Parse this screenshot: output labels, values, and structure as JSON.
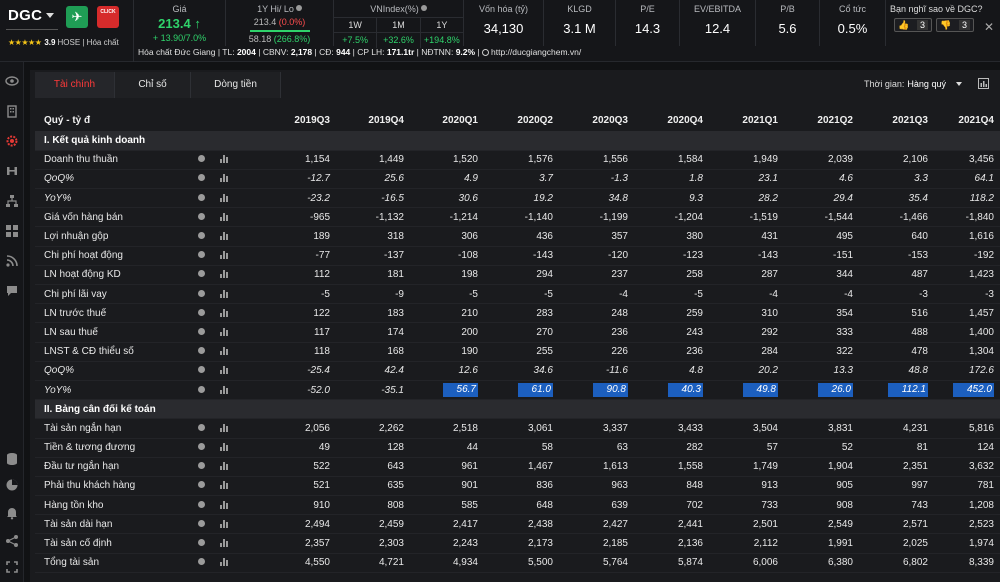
{
  "header": {
    "ticker": "DGC",
    "badge_green": "✈",
    "badge_red": "CLICK",
    "rating_stars": "★★★★★",
    "rating_score": "3.9",
    "exchange_industry": "HOSE | Hóa chất",
    "price": {
      "label": "Giá",
      "value": "213.4 ↑",
      "change": "+ 13.90/7.0%"
    },
    "hilo": {
      "label": "1Y Hi/ Lo",
      "hi": "213.4",
      "hi_pct": "(0.0%)",
      "lo": "58.18",
      "lo_pct": "(266.8%)"
    },
    "vnindex": {
      "label": "VNIndex(%)",
      "periods": [
        "1W",
        "1M",
        "1Y"
      ],
      "values": [
        "+7.5%",
        "+32.6%",
        "+194.8%"
      ]
    },
    "metrics": [
      {
        "label": "Vốn hóa (tỷ)",
        "value": "34,130"
      },
      {
        "label": "KLGD",
        "value": "3.1 M"
      },
      {
        "label": "P/E",
        "value": "14.3"
      },
      {
        "label": "EV/EBITDA",
        "value": "12.4"
      },
      {
        "label": "P/B",
        "value": "5.6"
      },
      {
        "label": "Cổ tức",
        "value": "0.5%"
      }
    ],
    "vote": {
      "question": "Bạn nghĩ sao về DGC?",
      "up_count": "3",
      "down_count": "3",
      "close": "✕"
    },
    "subinfo": {
      "company": "Hóa chất Đức Giang",
      "tl_label": "TL:",
      "tl": "2004",
      "cbnv_label": "CBNV:",
      "cbnv": "2,178",
      "cd_label": "CĐ:",
      "cd": "944",
      "cplh_label": "CP LH:",
      "cplh": "171.1tr",
      "ndtnn_label": "NĐTNN:",
      "ndtnn": "9.2%",
      "website": "http://ducgiangchem.vn/"
    }
  },
  "sidebar": {
    "icons": [
      "eye-icon",
      "building-icon",
      "gear-icon",
      "scale-icon",
      "sitemap-icon",
      "grid-icon",
      "rss-icon",
      "comment-icon",
      "database-icon",
      "pie-icon",
      "bell-icon",
      "share-icon",
      "expand-icon"
    ]
  },
  "panel": {
    "tabs": [
      "Tài chính",
      "Chỉ số",
      "Dòng tiền"
    ],
    "period_label": "Thời gian:",
    "period_value": "Hàng quý",
    "table": {
      "header_label": "Quý - tỷ đ",
      "columns": [
        "2019Q3",
        "2019Q4",
        "2020Q1",
        "2020Q2",
        "2020Q3",
        "2020Q4",
        "2021Q1",
        "2021Q2",
        "2021Q3",
        "2021Q4"
      ],
      "sections": [
        {
          "title": "I. Kết quả kinh doanh",
          "rows": [
            {
              "label": "Doanh thu thuần",
              "values": [
                "1,154",
                "1,449",
                "1,520",
                "1,576",
                "1,556",
                "1,584",
                "1,949",
                "2,039",
                "2,106",
                "3,456"
              ]
            },
            {
              "label": "QoQ%",
              "italic": true,
              "values": [
                "-12.7",
                "25.6",
                "4.9",
                "3.7",
                "-1.3",
                "1.8",
                "23.1",
                "4.6",
                "3.3",
                "64.1"
              ]
            },
            {
              "label": "YoY%",
              "italic": true,
              "values": [
                "-23.2",
                "-16.5",
                "30.6",
                "19.2",
                "34.8",
                "9.3",
                "28.2",
                "29.4",
                "35.4",
                "118.2"
              ]
            },
            {
              "label": "Giá vốn hàng bán",
              "values": [
                "-965",
                "-1,132",
                "-1,214",
                "-1,140",
                "-1,199",
                "-1,204",
                "-1,519",
                "-1,544",
                "-1,466",
                "-1,840"
              ]
            },
            {
              "label": "Lợi nhuận gộp",
              "values": [
                "189",
                "318",
                "306",
                "436",
                "357",
                "380",
                "431",
                "495",
                "640",
                "1,616"
              ]
            },
            {
              "label": "Chi phí hoạt động",
              "values": [
                "-77",
                "-137",
                "-108",
                "-143",
                "-120",
                "-123",
                "-143",
                "-151",
                "-153",
                "-192"
              ]
            },
            {
              "label": "LN hoạt động KD",
              "values": [
                "112",
                "181",
                "198",
                "294",
                "237",
                "258",
                "287",
                "344",
                "487",
                "1,423"
              ]
            },
            {
              "label": "Chi phí lãi vay",
              "values": [
                "-5",
                "-9",
                "-5",
                "-5",
                "-4",
                "-5",
                "-4",
                "-4",
                "-3",
                "-3"
              ]
            },
            {
              "label": "LN trước thuế",
              "values": [
                "122",
                "183",
                "210",
                "283",
                "248",
                "259",
                "310",
                "354",
                "516",
                "1,457"
              ]
            },
            {
              "label": "LN sau thuế",
              "values": [
                "117",
                "174",
                "200",
                "270",
                "236",
                "243",
                "292",
                "333",
                "488",
                "1,400"
              ]
            },
            {
              "label": "LNST & CĐ thiểu số",
              "values": [
                "118",
                "168",
                "190",
                "255",
                "226",
                "236",
                "284",
                "322",
                "478",
                "1,304"
              ]
            },
            {
              "label": "QoQ%",
              "italic": true,
              "values": [
                "-25.4",
                "42.4",
                "12.6",
                "34.6",
                "-11.6",
                "4.8",
                "20.2",
                "13.3",
                "48.8",
                "172.6"
              ]
            },
            {
              "label": "YoY%",
              "italic": true,
              "highlight_from": 2,
              "values": [
                "-52.0",
                "-35.1",
                "56.7",
                "61.0",
                "90.8",
                "40.3",
                "49.8",
                "26.0",
                "112.1",
                "452.0"
              ]
            }
          ]
        },
        {
          "title": "II. Bảng cân đối kế toán",
          "rows": [
            {
              "label": "Tài sản ngắn hạn",
              "values": [
                "2,056",
                "2,262",
                "2,518",
                "3,061",
                "3,337",
                "3,433",
                "3,504",
                "3,831",
                "4,231",
                "5,816"
              ]
            },
            {
              "label": "Tiền & tương đương",
              "values": [
                "49",
                "128",
                "44",
                "58",
                "63",
                "282",
                "57",
                "52",
                "81",
                "124"
              ]
            },
            {
              "label": "Đầu tư ngắn hạn",
              "values": [
                "522",
                "643",
                "961",
                "1,467",
                "1,613",
                "1,558",
                "1,749",
                "1,904",
                "2,351",
                "3,632"
              ]
            },
            {
              "label": "Phải thu khách hàng",
              "values": [
                "521",
                "635",
                "901",
                "836",
                "963",
                "848",
                "913",
                "905",
                "997",
                "781"
              ]
            },
            {
              "label": "Hàng tồn kho",
              "values": [
                "910",
                "808",
                "585",
                "648",
                "639",
                "702",
                "733",
                "908",
                "743",
                "1,208"
              ]
            },
            {
              "label": "Tài sản dài hạn",
              "values": [
                "2,494",
                "2,459",
                "2,417",
                "2,438",
                "2,427",
                "2,441",
                "2,501",
                "2,549",
                "2,571",
                "2,523"
              ]
            },
            {
              "label": "Tài sản cố định",
              "values": [
                "2,357",
                "2,303",
                "2,243",
                "2,173",
                "2,185",
                "2,136",
                "2,112",
                "1,991",
                "2,025",
                "1,974"
              ]
            },
            {
              "label": "Tổng tài sản",
              "values": [
                "4,550",
                "4,721",
                "4,934",
                "5,500",
                "5,764",
                "5,874",
                "6,006",
                "6,380",
                "6,802",
                "8,339"
              ]
            }
          ]
        }
      ]
    }
  }
}
